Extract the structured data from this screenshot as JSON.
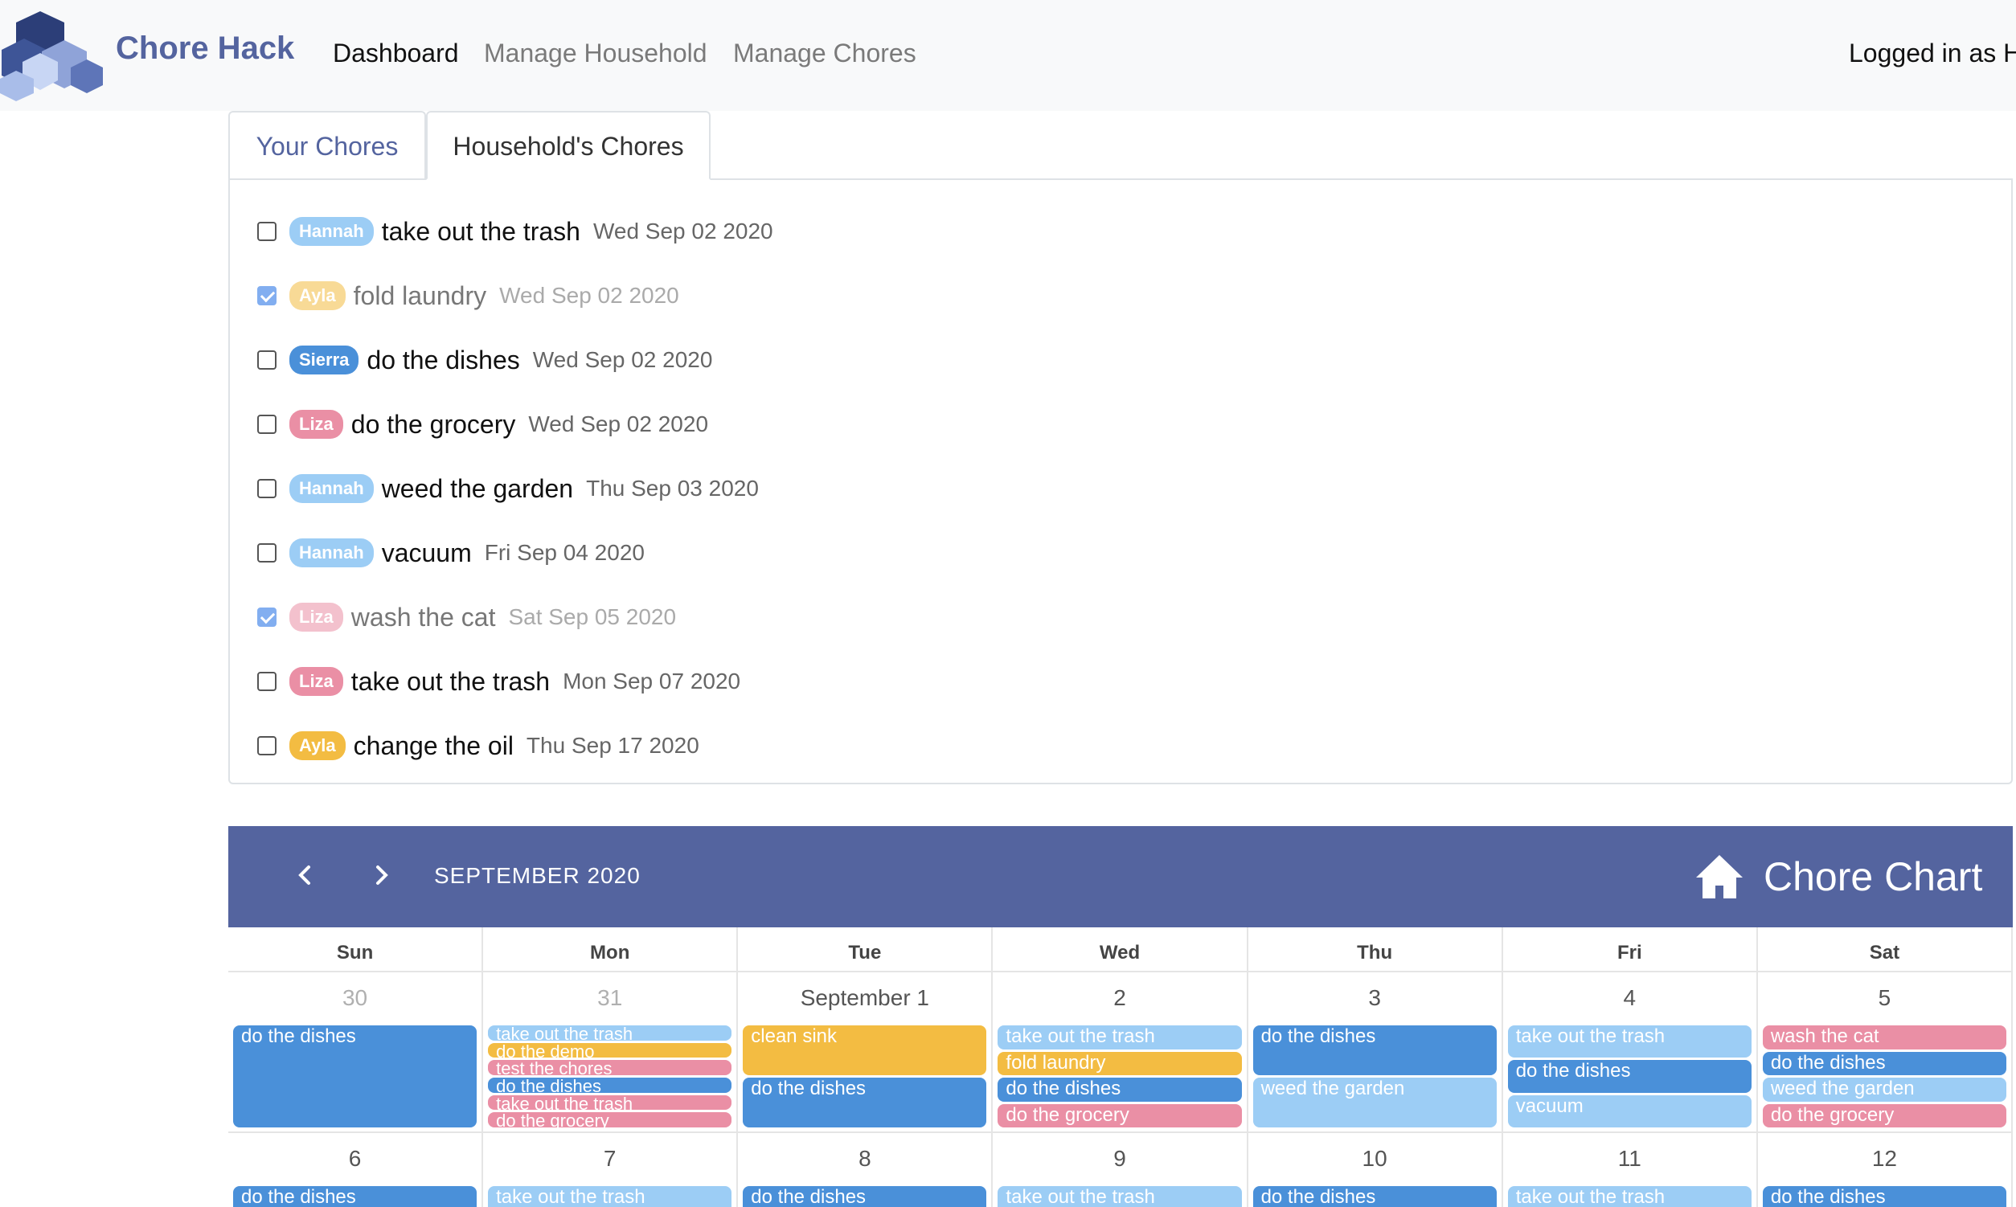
{
  "app": {
    "brand": "Chore Hack"
  },
  "nav": {
    "links": [
      "Dashboard",
      "Manage Household",
      "Manage Chores"
    ],
    "active": "Dashboard",
    "user_status": "Logged in as H"
  },
  "tabs": {
    "yours": "Your Chores",
    "household": "Household's Chores",
    "active": "household"
  },
  "colors": {
    "Hannah": "#9ccdf5",
    "Ayla": "#f3bc42",
    "Sierra": "#4a90d9",
    "Liza": "#ea8fa5",
    "header": "#54649f"
  },
  "chores": [
    {
      "member": "Hannah",
      "title": "take out the trash",
      "date": "Wed Sep 02 2020",
      "done": false
    },
    {
      "member": "Ayla",
      "title": "fold laundry",
      "date": "Wed Sep 02 2020",
      "done": true
    },
    {
      "member": "Sierra",
      "title": "do the dishes",
      "date": "Wed Sep 02 2020",
      "done": false
    },
    {
      "member": "Liza",
      "title": "do the grocery",
      "date": "Wed Sep 02 2020",
      "done": false
    },
    {
      "member": "Hannah",
      "title": "weed the garden",
      "date": "Thu Sep 03 2020",
      "done": false
    },
    {
      "member": "Hannah",
      "title": "vacuum",
      "date": "Fri Sep 04 2020",
      "done": false
    },
    {
      "member": "Liza",
      "title": "wash the cat",
      "date": "Sat Sep 05 2020",
      "done": true
    },
    {
      "member": "Liza",
      "title": "take out the trash",
      "date": "Mon Sep 07 2020",
      "done": false
    },
    {
      "member": "Ayla",
      "title": "change the oil",
      "date": "Thu Sep 17 2020",
      "done": false
    }
  ],
  "calendar": {
    "month_label": "SEPTEMBER 2020",
    "title": "Chore Chart",
    "weekdays": [
      "Sun",
      "Mon",
      "Tue",
      "Wed",
      "Thu",
      "Fri",
      "Sat"
    ],
    "weeks": [
      [
        {
          "label": "30",
          "muted": true,
          "events": [
            {
              "title": "do the dishes",
              "member": "Sierra"
            }
          ]
        },
        {
          "label": "31",
          "muted": true,
          "events": [
            {
              "title": "take out the trash",
              "member": "Hannah"
            },
            {
              "title": "do the demo",
              "member": "Ayla"
            },
            {
              "title": "test the chores",
              "member": "Liza"
            },
            {
              "title": "do the dishes",
              "member": "Sierra"
            },
            {
              "title": "take out the trash",
              "member": "Liza"
            },
            {
              "title": "do the grocery",
              "member": "Liza"
            }
          ]
        },
        {
          "label": "September 1",
          "muted": false,
          "events": [
            {
              "title": "clean sink",
              "member": "Ayla"
            },
            {
              "title": "do the dishes",
              "member": "Sierra"
            }
          ]
        },
        {
          "label": "2",
          "muted": false,
          "events": [
            {
              "title": "take out the trash",
              "member": "Hannah"
            },
            {
              "title": "fold laundry",
              "member": "Ayla"
            },
            {
              "title": "do the dishes",
              "member": "Sierra"
            },
            {
              "title": "do the grocery",
              "member": "Liza"
            }
          ]
        },
        {
          "label": "3",
          "muted": false,
          "events": [
            {
              "title": "do the dishes",
              "member": "Sierra"
            },
            {
              "title": "weed the garden",
              "member": "Hannah"
            }
          ]
        },
        {
          "label": "4",
          "muted": false,
          "events": [
            {
              "title": "take out the trash",
              "member": "Hannah"
            },
            {
              "title": "do the dishes",
              "member": "Sierra"
            },
            {
              "title": "vacuum",
              "member": "Hannah"
            }
          ]
        },
        {
          "label": "5",
          "muted": false,
          "events": [
            {
              "title": "wash the cat",
              "member": "Liza"
            },
            {
              "title": "do the dishes",
              "member": "Sierra"
            },
            {
              "title": "weed the garden",
              "member": "Hannah"
            },
            {
              "title": "do the grocery",
              "member": "Liza"
            }
          ]
        }
      ],
      [
        {
          "label": "6",
          "muted": false,
          "events": [
            {
              "title": "do the dishes",
              "member": "Sierra"
            }
          ]
        },
        {
          "label": "7",
          "muted": false,
          "events": [
            {
              "title": "take out the trash",
              "member": "Hannah"
            }
          ]
        },
        {
          "label": "8",
          "muted": false,
          "events": [
            {
              "title": "do the dishes",
              "member": "Sierra"
            }
          ]
        },
        {
          "label": "9",
          "muted": false,
          "events": [
            {
              "title": "take out the trash",
              "member": "Hannah"
            }
          ]
        },
        {
          "label": "10",
          "muted": false,
          "events": [
            {
              "title": "do the dishes",
              "member": "Sierra"
            }
          ]
        },
        {
          "label": "11",
          "muted": false,
          "events": [
            {
              "title": "take out the trash",
              "member": "Hannah"
            }
          ]
        },
        {
          "label": "12",
          "muted": false,
          "events": [
            {
              "title": "do the dishes",
              "member": "Sierra"
            }
          ]
        }
      ]
    ]
  }
}
